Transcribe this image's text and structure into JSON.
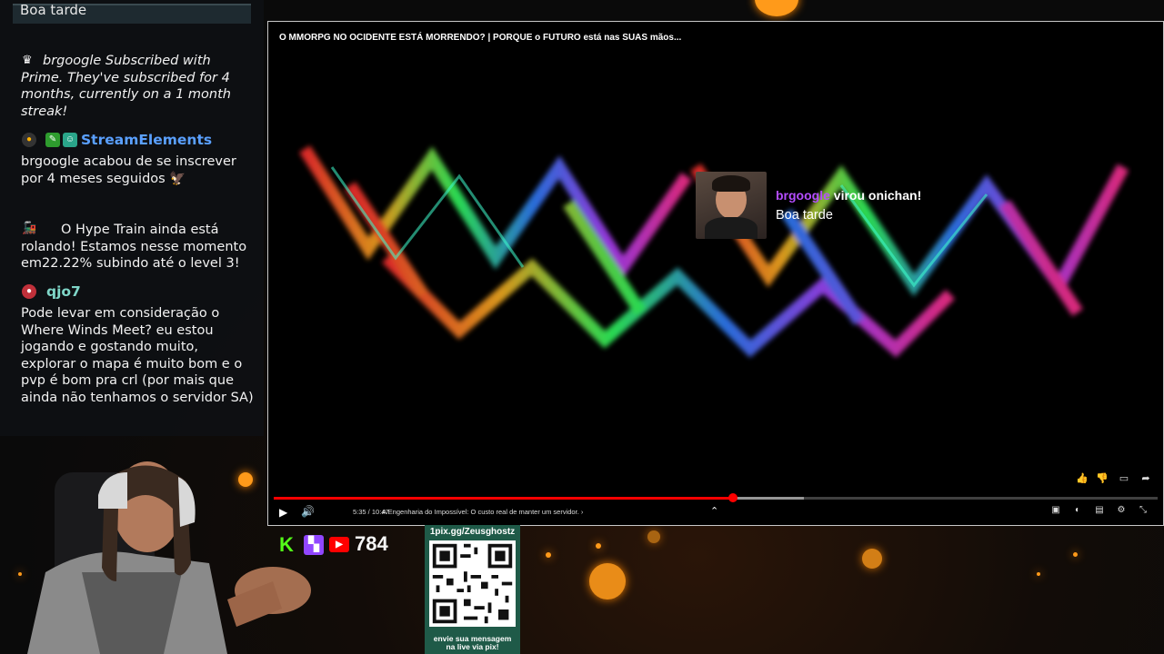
{
  "chat": {
    "top_message": "Boa tarde",
    "messages": [
      {
        "type": "subscription",
        "icon": "crown-icon",
        "text": "brgoogle Subscribed with Prime. They've subscribed for 4 months, currently on a 1 month streak!"
      },
      {
        "type": "chat",
        "user": "StreamElements",
        "user_color": "#5aa0ff",
        "text": "brgoogle acabou de se inscrever por 4 meses seguidos 🦅"
      },
      {
        "type": "chat",
        "user": "",
        "text": "O Hype Train ainda está rolando! Estamos nesse momento em22.22% subindo até o level 3!"
      },
      {
        "type": "chat",
        "user": "qjo7",
        "user_color": "#7fd6c8",
        "text": "Pode levar em consideração o Where Winds Meet? eu estou jogando e gostando muito, explorar o mapa é muito bom e o pvp é bom pra crl (por mais que ainda não tenhamos o servidor SA)"
      }
    ]
  },
  "player": {
    "title": "O MMORPG NO OCIDENTE ESTÁ MORRENDO? | PORQUE o FUTURO está nas SUAS mãos...",
    "time": "5:35 / 10:47",
    "chapter": "A Engenharia do Impossível: O custo real de manter um servidor.",
    "progress": 0.52,
    "buffered": 0.6,
    "overlay": {
      "username": "brgoogle",
      "username_color": "#b44dff",
      "action": " virou onichan!",
      "message": "Boa tarde"
    }
  },
  "social": {
    "viewer_count": "784",
    "platforms": [
      "kick-icon",
      "twitch-icon",
      "youtube-icon"
    ]
  },
  "pix": {
    "header": "1pix.gg/Zeusghostz",
    "footer_line1": "envie sua mensagem",
    "footer_line2": "na live via pix!"
  },
  "colors": {
    "progress": "#ff0000",
    "pix_bg": "#1f5a48",
    "kick": "#53fc18",
    "twitch": "#9146ff",
    "youtube": "#ff0000"
  }
}
